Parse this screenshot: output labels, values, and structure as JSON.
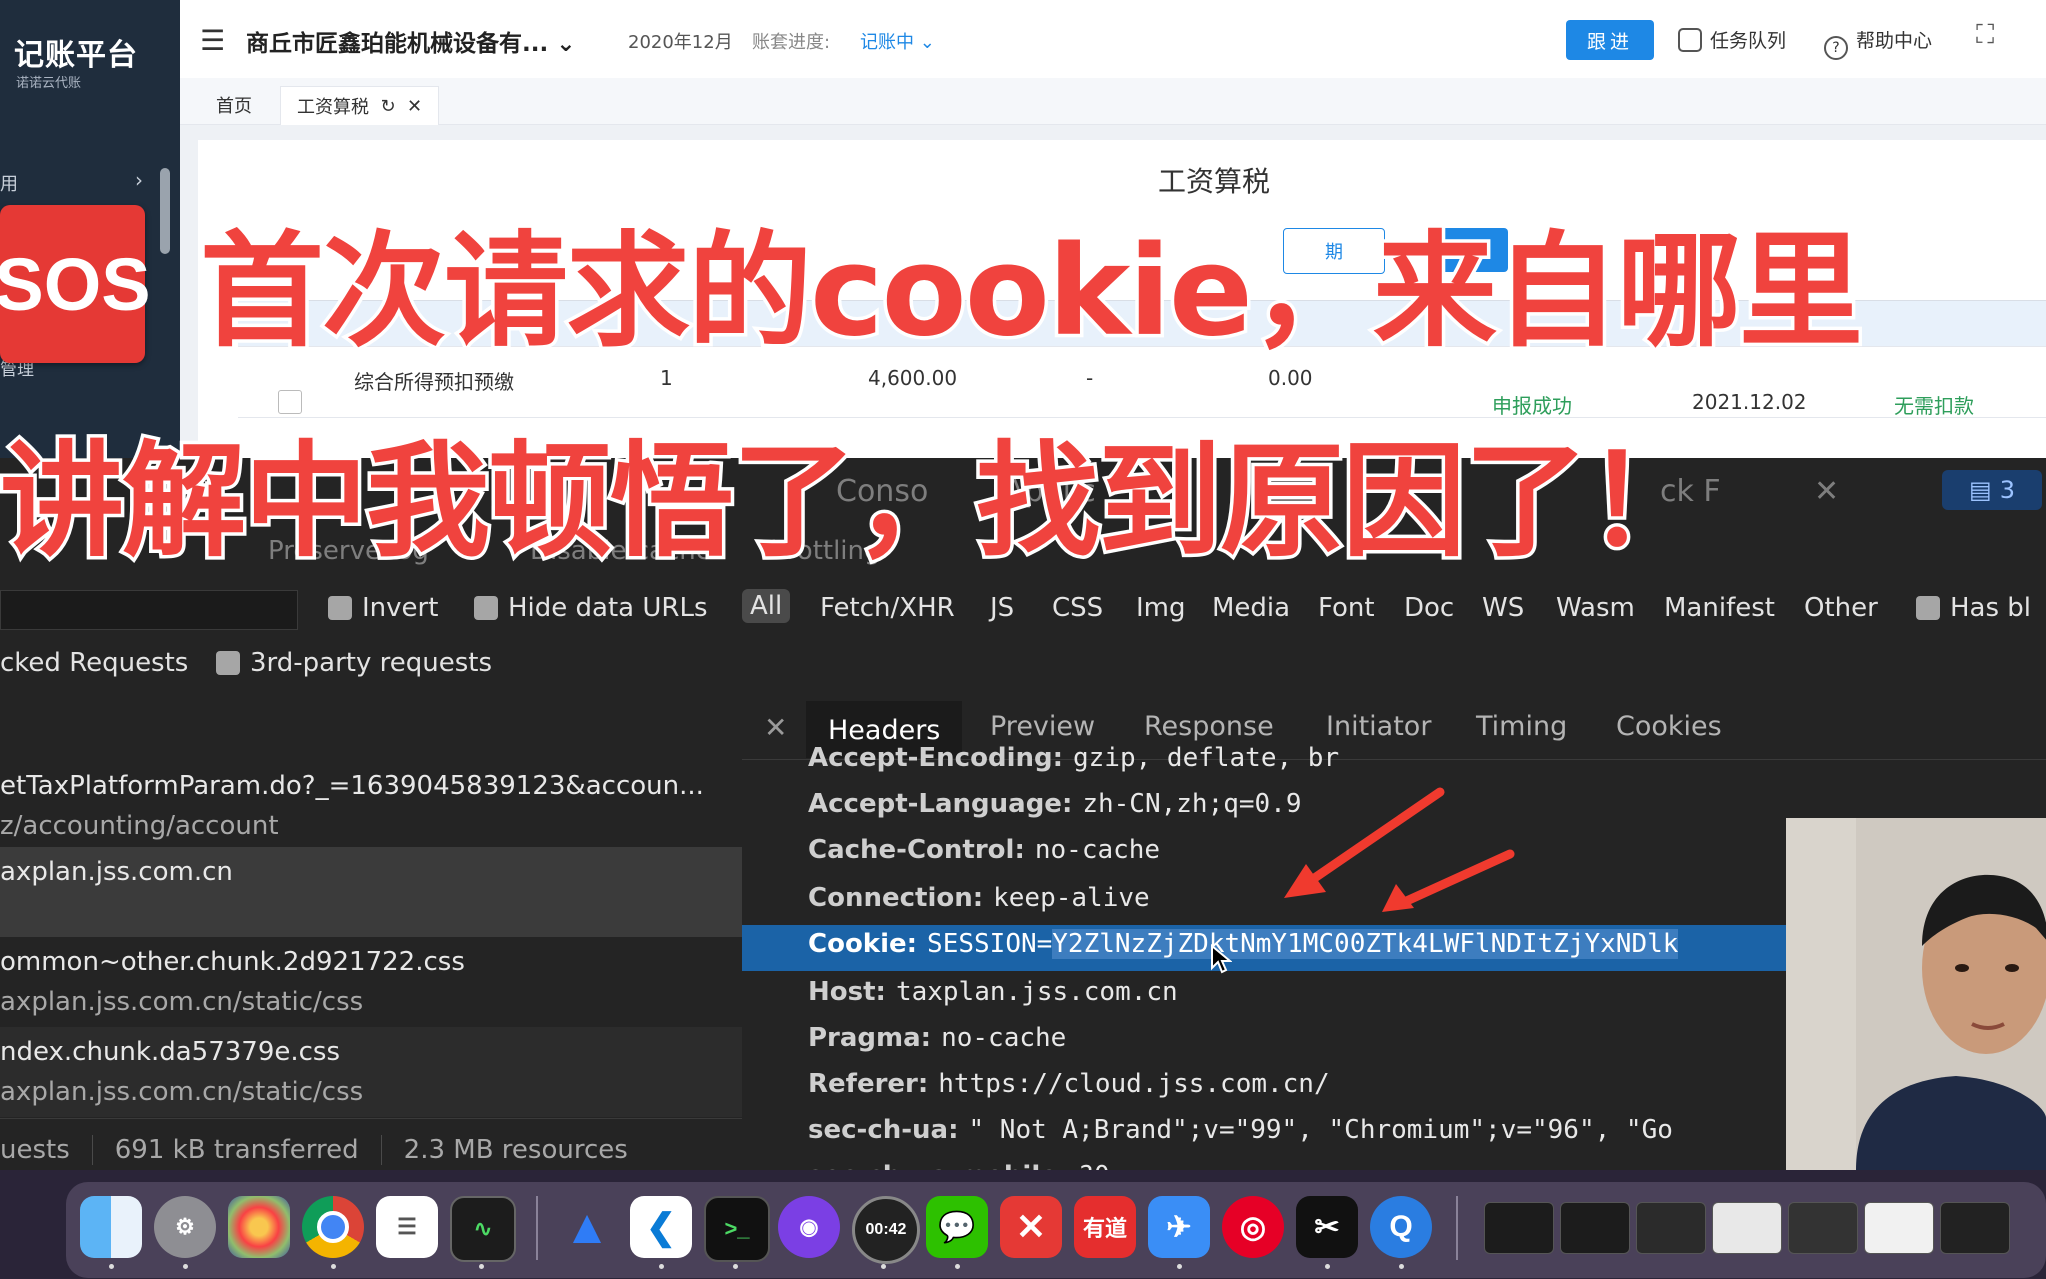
{
  "app": {
    "logo_main": "记账平台",
    "logo_sub": "诺诺云代账",
    "sidebar_item": "用",
    "sidebar_item2": "管理",
    "sos_label": "SOS",
    "company": "商丘市匠鑫珀能机械设备有...",
    "period": "2020年12月",
    "progress_label": "账套进度:",
    "progress_value": "记账中",
    "follow_button": "跟进",
    "task_queue": "任务队列",
    "help_center": "帮助中心",
    "tabs": [
      "首页",
      "工资算税"
    ],
    "page_title": "工资算税",
    "btn_period": "期",
    "btn_declare": "申",
    "row": {
      "type": "综合所得预扣预缴",
      "count": "1",
      "income": "4,600.00",
      "dash": "-",
      "tax": "0.00",
      "status": "申报成功",
      "date": "2021.12.02",
      "deduct": "无需扣款"
    }
  },
  "overlay": {
    "line1": "首次请求的cookie，来自哪里",
    "line2": "讲解中我顿悟了，找到原因了！"
  },
  "devtools": {
    "top_tabs": [
      "Conso",
      "Applic",
      "ck F"
    ],
    "issues_count": "3",
    "toolbar": [
      "Preserve log",
      "Disable cache",
      "throttling"
    ],
    "filter_checks": [
      "Invert",
      "Hide data URLs"
    ],
    "filter_types": [
      "All",
      "Fetch/XHR",
      "JS",
      "CSS",
      "Img",
      "Media",
      "Font",
      "Doc",
      "WS",
      "Wasm",
      "Manifest",
      "Other"
    ],
    "has_blocked": "Has bl",
    "blocked_requests": "cked Requests",
    "third_party": "3rd-party requests",
    "requests": [
      {
        "name": "etTaxPlatformParam.do?_=1639045839123&accoun...",
        "path": "z/accounting/account"
      },
      {
        "name": "axplan.jss.com.cn",
        "path": ""
      },
      {
        "name": "ommon~other.chunk.2d921722.css",
        "path": "axplan.jss.com.cn/static/css"
      },
      {
        "name": "ndex.chunk.da57379e.css",
        "path": "axplan.jss.com.cn/static/css"
      }
    ],
    "status": [
      "uests",
      "691 kB transferred",
      "2.3 MB resources"
    ],
    "detail_tabs": [
      "Headers",
      "Preview",
      "Response",
      "Initiator",
      "Timing",
      "Cookies"
    ],
    "headers": [
      {
        "k": "Accept-Encoding:",
        "v": "gzip, deflate, br"
      },
      {
        "k": "Accept-Language:",
        "v": "zh-CN,zh;q=0.9"
      },
      {
        "k": "Cache-Control:",
        "v": "no-cache"
      },
      {
        "k": "Connection:",
        "v": "keep-alive"
      },
      {
        "k": "Cookie:",
        "v": "SESSION=",
        "v_sel": "Y2ZlNzZjZDktNmY1MC00ZTk4LWFlNDItZjYxNDlk"
      },
      {
        "k": "Host:",
        "v": "taxplan.jss.com.cn"
      },
      {
        "k": "Pragma:",
        "v": "no-cache"
      },
      {
        "k": "Referer:",
        "v": "https://cloud.jss.com.cn/"
      },
      {
        "k": "sec-ch-ua:",
        "v": "\" Not A;Brand\";v=\"99\", \"Chromium\";v=\"96\", \"Go"
      },
      {
        "k": "sec-ch-ua-mobile:",
        "v": "?0"
      }
    ]
  },
  "dock": {
    "apps": [
      "finder",
      "system-preferences",
      "photos",
      "chrome",
      "reminders",
      "activity-monitor",
      "xcode-instruments",
      "vscode",
      "terminal",
      "github-desktop",
      "timer",
      "wechat",
      "xmind",
      "youdao",
      "feishu",
      "netease-music",
      "capcut",
      "quicktime"
    ],
    "timer_label": "00:42",
    "youdao_label": "有道",
    "terminal_label": ">_"
  },
  "colors": {
    "headline": "#f0433e",
    "accent": "#1e88e5",
    "selected_row": "#1b63a7",
    "devtools_bg": "#242424"
  }
}
